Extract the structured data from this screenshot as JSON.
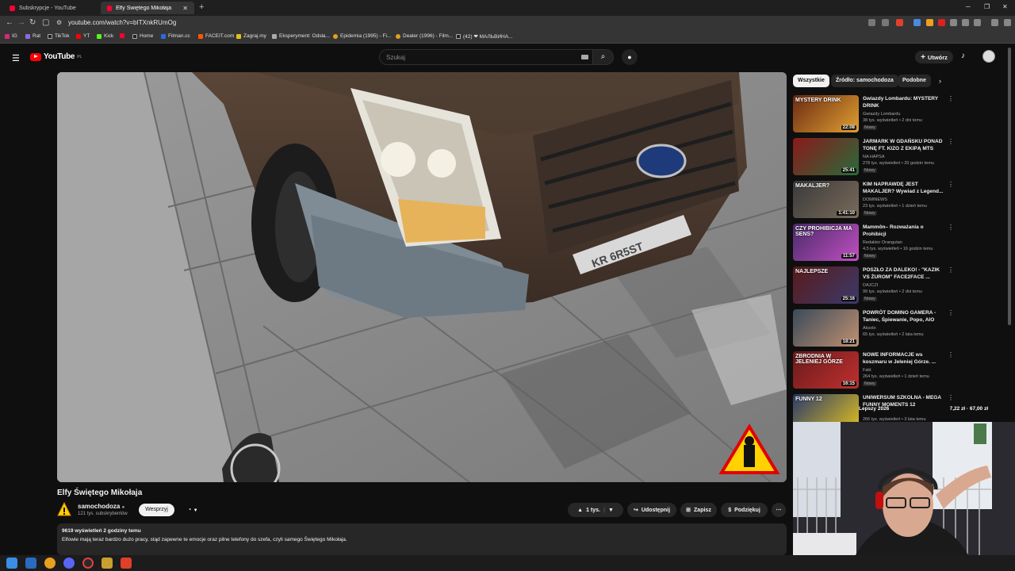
{
  "browser": {
    "tabs": [
      {
        "title": "Subskrypcje - YouTube",
        "active": false
      },
      {
        "title": "Elfy Świętego Mikołaja - YouTu",
        "active": true
      }
    ],
    "new_tab": "+",
    "url": "youtube.com/watch?v=bITXnkRUmOg",
    "bookmarks": [
      "IG",
      "Rat",
      "TikTok",
      "YT",
      "Kick",
      "",
      "Home",
      "Filman.cc",
      "FACEIT.com",
      "Zagraj.my",
      "Eksperyment: Odsła...",
      "Epidemia (1995) - Fi...",
      "Dealer (1996) - Film...",
      "(42) ❤ МАЛЬВИНА..."
    ]
  },
  "header": {
    "logo_text": "YouTube",
    "logo_region": "PL",
    "search_placeholder": "Szukaj",
    "create_label": "Utwórz"
  },
  "video": {
    "title": "Elfy Świętego Mikołaja",
    "channel": "samochodoza",
    "subscribers": "121 tys. subskrybentów",
    "support_label": "Wesprzyj",
    "likes": "1 tys.",
    "share_label": "Udostępnij",
    "save_label": "Zapisz",
    "thanks_label": "Podziękuj",
    "views_meta": "9619 wyświetleń  2 godziny temu",
    "description": "Elfowie mają teraz bardzo dużo pracy, stąd zapewne te emocje oraz pilne telefony do szefa, czyli samego Świętego Mikołaja.",
    "plate_text": "KR 6R5ST"
  },
  "chips": [
    "Wszystkie",
    "Źródło: samochodoza",
    "Podobne"
  ],
  "recommendations": [
    {
      "title": "Gwiazdy Lombardu: MYSTERY DRINK",
      "channel": "Gwiazdy Lombardu",
      "meta": "38 tys. wyświetleń • 2 dni temu",
      "badge": "Nowy",
      "duration": "22:08",
      "thumb_text": "MYSTERY DRINK",
      "color1": "#6b2a14",
      "color2": "#e0a030"
    },
    {
      "title": "JARMARK W GDAŃSKU PONAD TONĘ FT. KIZO Z EKIPĄ MTS",
      "channel": "NA HAPSA",
      "meta": "278 tys. wyświetleń • 20 godzin temu",
      "badge": "Nowy",
      "duration": "25:41",
      "thumb_text": "",
      "color1": "#8a1a1a",
      "color2": "#2a6a3a"
    },
    {
      "title": "KIM NAPRAWDĘ JEST MAKALJER? Wywiad z Legend...",
      "channel": "DOMINEWS",
      "meta": "23 tys. wyświetleń • 1 dzień temu",
      "badge": "Nowy",
      "duration": "1:41:10",
      "thumb_text": "MAKALJER?",
      "color1": "#3a3a3a",
      "color2": "#7a6a5a"
    },
    {
      "title": "Mammôn– Rozważania o Prohibicji",
      "channel": "Redaktor Orangutan",
      "meta": "4,5 tys. wyświetleń • 16 godzin temu",
      "badge": "Nowy",
      "duration": "11:57",
      "thumb_text": "CZY PROHIBICJA MA SENS?",
      "color1": "#4a2a6a",
      "color2": "#c050c0"
    },
    {
      "title": "POSZŁO ZA DALEKO! - \"KAZIK VS ŻUROM\" FACE2FACE ...",
      "channel": "DAJCZI",
      "meta": "99 tys. wyświetleń • 2 dni temu",
      "badge": "Nowy",
      "duration": "25:16",
      "thumb_text": "NAJLEPSZE",
      "color1": "#5a1a1a",
      "color2": "#3a3a6a"
    },
    {
      "title": "POWRÓT DOMINO GAMERA - Taniec, Śpiewanie, Popo, AIO",
      "channel": "Aksolo",
      "meta": "65 tys. wyświetleń • 2 lata temu",
      "badge": "",
      "duration": "18:21",
      "thumb_text": "",
      "color1": "#3a4a5a",
      "color2": "#c09070"
    },
    {
      "title": "NOWE INFORMACJE ws koszmaru w Jeleniej Górze. ...",
      "channel": "Fakt",
      "meta": "264 tys. wyświetleń • 1 dzień temu",
      "badge": "Nowy",
      "duration": "16:15",
      "thumb_text": "ZBRODNIA W JELENIEJ GÓRZE",
      "color1": "#6a1a1a",
      "color2": "#c03030"
    },
    {
      "title": "UNIWERSUM SZKOLNA - MEGA FUNNY MOMENTS 12",
      "channel": "",
      "meta": "266 tys. wyświetleń • 3 lata temu",
      "badge": "",
      "duration": "",
      "thumb_text": "FUNNY 12",
      "color1": "#2a3a6a",
      "color2": "#e0c020"
    }
  ],
  "overlay": {
    "left": "Lepszy 2026",
    "right": "7,22 zł  ·  67,00 zł"
  },
  "icons": {
    "hamburger": "☰",
    "search": "⌕",
    "mic": "🎙",
    "bell": "🔔",
    "like": "👍",
    "dislike": "👎",
    "share": "↪",
    "save": "⊞",
    "more": "⋯",
    "next": "›"
  }
}
